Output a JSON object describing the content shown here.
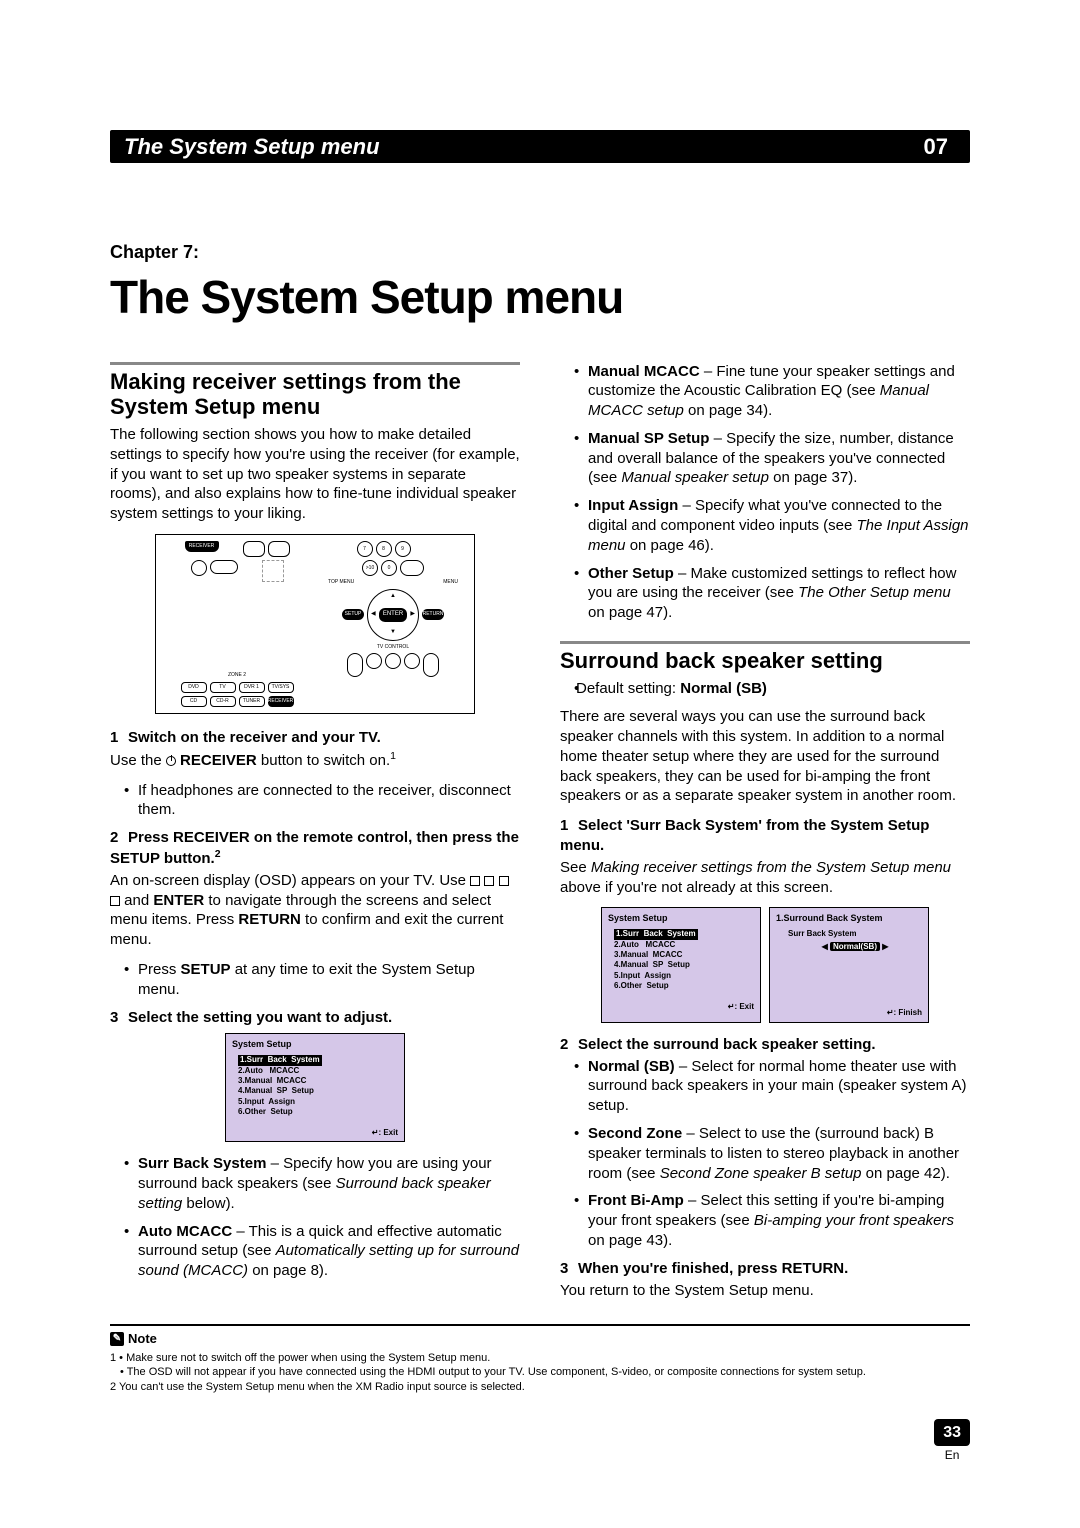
{
  "header": {
    "title": "The System Setup menu",
    "badge": "07"
  },
  "chapter": {
    "label": "Chapter 7:",
    "title": "The System Setup menu"
  },
  "left": {
    "sec1_h": "Making receiver settings from the System Setup menu",
    "intro": "The following section shows you how to make detailed settings to specify how you're using the receiver (for example, if you want to set up two speaker systems in separate rooms), and also explains how to fine-tune individual speaker system settings to your liking.",
    "step1_h": "Switch on the receiver and your TV.",
    "step1_body_a": "Use the ",
    "step1_body_b": " RECEIVER",
    "step1_body_c": " button to switch on.",
    "step1_sup": "1",
    "step1_bullet": "If headphones are connected to the receiver, disconnect them.",
    "step2_h": "Press RECEIVER on the remote control, then press the SETUP button.",
    "step2_sup": "2",
    "step2_p_a": "An on-screen display (OSD) appears on your TV. Use ",
    "step2_p_b": " and ",
    "step2_p_c": "ENTER",
    "step2_p_d": " to navigate through the screens and select menu items. Press ",
    "step2_p_e": "RETURN",
    "step2_p_f": " to confirm and exit the current menu.",
    "step2_bullet_a": "Press ",
    "step2_bullet_b": "SETUP",
    "step2_bullet_c": " at any time to exit the System Setup menu.",
    "step3_h": "Select the setting you want to adjust.",
    "osd1": {
      "title": "System  Setup",
      "items": [
        "1.Surr  Back  System",
        "2.Auto   MCACC",
        "3.Manual  MCACC",
        "4.Manual  SP  Setup",
        "5.Input  Assign",
        "6.Other  Setup"
      ],
      "foot": ": Exit"
    },
    "b1_t": "Surr Back System",
    "b1_r_a": " – Specify how you are using your surround back speakers (see ",
    "b1_r_i": "Surround back speaker setting",
    "b1_r_b": " below).",
    "b2_t": "Auto MCACC",
    "b2_r_a": " – This is a quick and effective automatic surround setup (see ",
    "b2_r_i": "Automatically setting up for surround sound (MCACC)",
    "b2_r_b": " on page 8)."
  },
  "right": {
    "r1_t": "Manual MCACC",
    "r1_a": " – Fine tune your speaker settings and customize the Acoustic Calibration EQ (see ",
    "r1_i": "Manual MCACC setup",
    "r1_b": " on page 34).",
    "r2_t": "Manual SP Setup",
    "r2_a": " – Specify the size, number, distance and overall balance of the speakers you've connected (see ",
    "r2_i": "Manual speaker setup",
    "r2_b": " on page 37).",
    "r3_t": "Input Assign",
    "r3_a": " – Specify what you've connected to the digital and component video inputs (see ",
    "r3_i": "The Input Assign menu",
    "r3_b": " on page 46).",
    "r4_t": "Other Setup",
    "r4_a": " – Make customized settings to reflect how you are using the receiver (see ",
    "r4_i": "The Other Setup menu",
    "r4_b": " on page 47).",
    "sec2_h": "Surround back speaker setting",
    "default_a": "Default setting: ",
    "default_b": "Normal (SB)",
    "sb_intro": "There are several ways you can use the surround back speaker channels with this system. In addition to a normal home theater setup where they are used for the surround back speakers, they can be used for bi-amping the front speakers or as a separate speaker system in another room.",
    "sb_step1_h": "Select 'Surr Back System' from the System Setup menu.",
    "sb_step1_a": "See ",
    "sb_step1_i": "Making receiver settings from the System Setup menu",
    "sb_step1_b": " above if you're not already at this screen.",
    "osd2a": {
      "title": "System  Setup",
      "items": [
        "1.Surr  Back  System",
        "2.Auto   MCACC",
        "3.Manual  MCACC",
        "4.Manual  SP  Setup",
        "5.Input  Assign",
        "6.Other  Setup"
      ],
      "foot": ": Exit"
    },
    "osd2b": {
      "title": "1.Surround   Back   System",
      "row_label": "Surr Back System",
      "row_value": "Normal(SB)",
      "foot": ": Finish"
    },
    "sb_step2_h": "Select the surround back speaker setting.",
    "sb_b1_t": "Normal (SB)",
    "sb_b1_r": " – Select for normal home theater use with surround back speakers in your main (speaker system A) setup.",
    "sb_b2_t": "Second Zone",
    "sb_b2_a": " – Select to use the (surround back) B speaker terminals to listen to stereo playback in another room (see ",
    "sb_b2_i": "Second Zone speaker B setup",
    "sb_b2_b": " on page 42).",
    "sb_b3_t": "Front Bi-Amp",
    "sb_b3_a": " – Select this setting if you're bi-amping your front speakers (see ",
    "sb_b3_i": "Bi-amping your front speakers",
    "sb_b3_b": " on page 43).",
    "sb_step3_h": "When you're finished, press RETURN.",
    "sb_step3_p": "You return to the System Setup menu."
  },
  "notes": {
    "head": "Note",
    "n1": "1 • Make sure not to switch off the power when using the System Setup menu.",
    "n1b": "• The OSD will not appear if you have connected using the HDMI output to your TV. Use component, S-video, or composite connections for system setup.",
    "n2": "2 You can't use the System Setup menu when the XM Radio input source is selected."
  },
  "page": {
    "num": "33",
    "lang": "En"
  },
  "remote": {
    "receiver": "RECEIVER",
    "enter": "ENTER",
    "return": "RETURN",
    "topmenu": "TOP MENU",
    "menu": "MENU",
    "setup": "SETUP",
    "tvcontrol": "TV CONTROL",
    "zone2": "ZONE 2",
    "dvd": "DVD",
    "tv": "TV",
    "dvr1": "DVR 1",
    "tvsys": "TV/SYS",
    "cd": "CD",
    "cdr": "CD-R",
    "tuner": "TUNER",
    "n7": "7",
    "n8": "8",
    "n9": "9",
    "n0": "0",
    "cir": ">10"
  }
}
